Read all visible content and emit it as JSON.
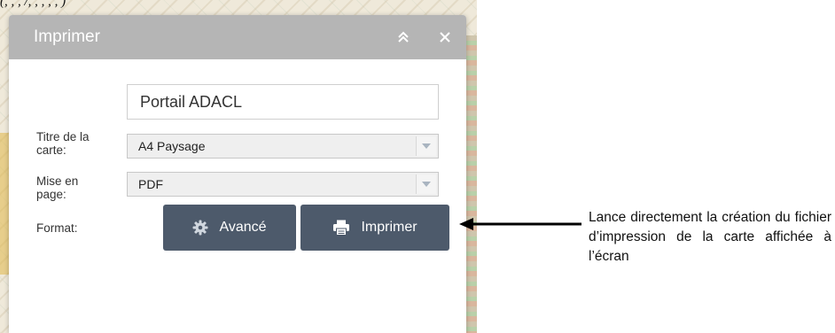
{
  "caption_top": "(,  ,  ,  /,  ,  ,  ,  ,  )",
  "dialog": {
    "title": "Imprimer",
    "collapse_icon": "double-chevron-up-icon",
    "close_icon": "close-icon",
    "fields": {
      "title_label": "Titre de la carte:",
      "title_value": "Portail ADACL",
      "layout_label": "Mise en page:",
      "layout_value": "A4 Paysage",
      "format_label": "Format:",
      "format_value": "PDF"
    },
    "buttons": {
      "advanced_label": "Avancé",
      "advanced_icon": "gear-icon",
      "print_label": "Imprimer",
      "print_icon": "printer-icon"
    }
  },
  "annotation": {
    "text": "Lance directement la création du fichier d’impression de la carte affichée à l’écran"
  },
  "colors": {
    "header_bg": "#b5b5b5",
    "button_bg": "#4d5a6b",
    "select_bg": "#efefef"
  }
}
